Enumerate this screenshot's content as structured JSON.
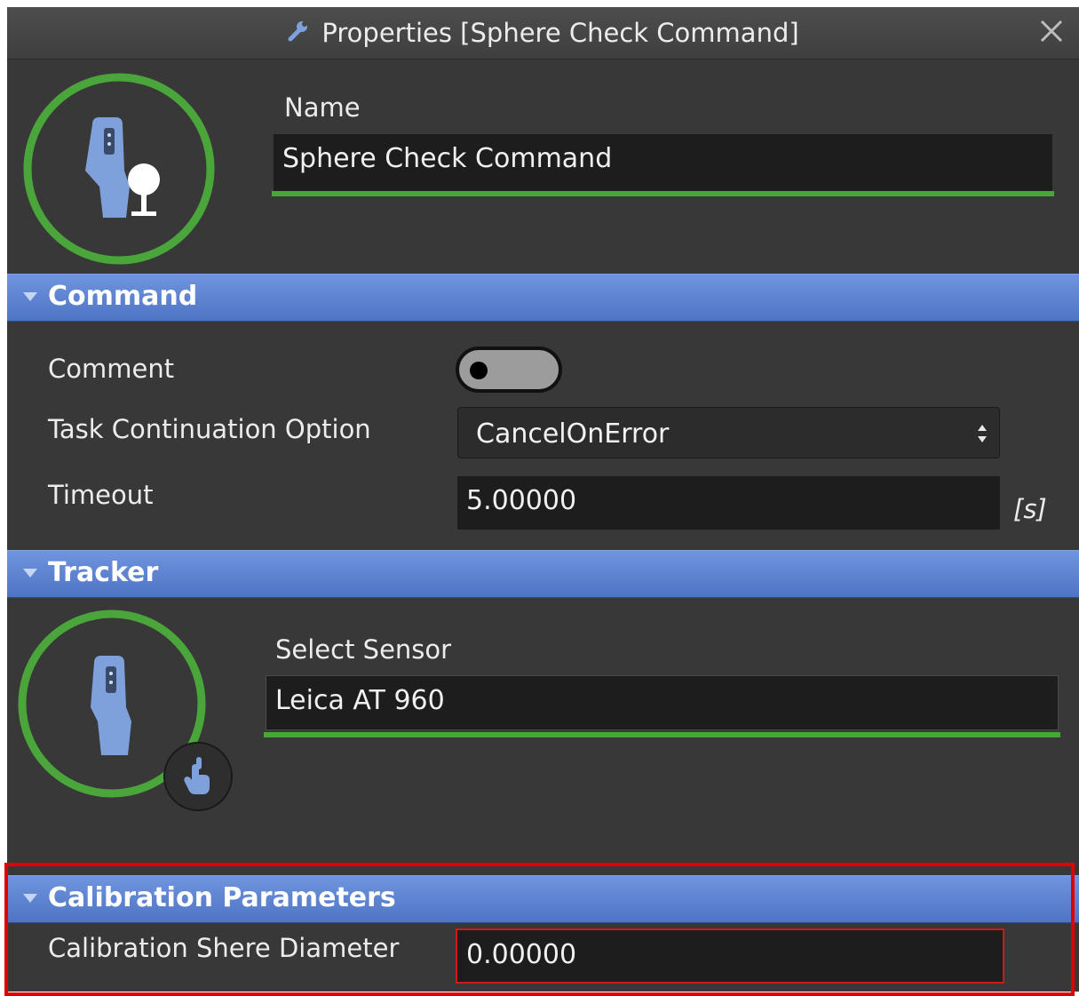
{
  "window": {
    "title": "Properties [Sphere Check Command]"
  },
  "header": {
    "name_label": "Name",
    "name_value": "Sphere Check Command"
  },
  "command_section": {
    "title": "Command",
    "comment_label": "Comment",
    "comment_enabled": false,
    "task_continuation_label": "Task Continuation Option",
    "task_continuation_value": "CancelOnError",
    "timeout_label": "Timeout",
    "timeout_value": "5.00000",
    "timeout_unit": "[s]"
  },
  "tracker_section": {
    "title": "Tracker",
    "select_sensor_label": "Select Sensor",
    "sensor_value": "Leica AT 960"
  },
  "calibration_section": {
    "title": "Calibration Parameters",
    "diameter_label": "Calibration Shere Diameter",
    "diameter_value": "0.00000"
  },
  "colors": {
    "panel_bg": "#383838",
    "section_header_blue": "#5f85d4",
    "accent_green": "#4aa63a",
    "icon_blue": "#7ea1dc",
    "highlight_red": "#e00000"
  },
  "icons": [
    "wrench-icon",
    "close-icon",
    "tracker-icon",
    "sphere-icon",
    "pointer-hand-icon"
  ]
}
